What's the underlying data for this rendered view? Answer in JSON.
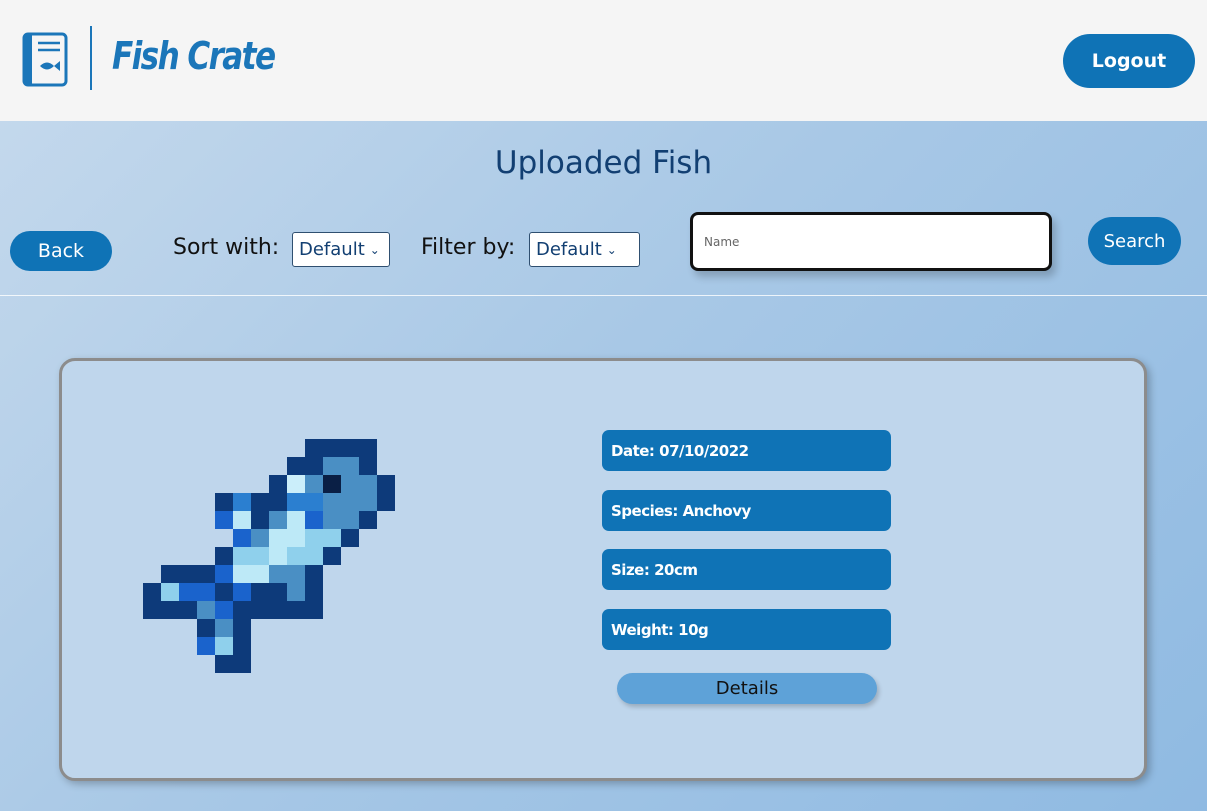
{
  "header": {
    "brand": "Fish Crate",
    "logo_icon": "fish-book-icon",
    "logout_label": "Logout"
  },
  "main": {
    "title": "Uploaded Fish",
    "back_label": "Back",
    "sort_label": "Sort with:",
    "sort_selected": "Default",
    "filter_label": "Filter by:",
    "filter_selected": "Default",
    "search_placeholder": "Name",
    "search_value": "",
    "search_label": "Search"
  },
  "fish_card": {
    "image": "pixel-fish-image",
    "date": "Date: 07/10/2022",
    "species": "Species: Anchovy",
    "size": "Size: 20cm",
    "weight": "Weight: 10g",
    "details_label": "Details"
  },
  "colors": {
    "accent": "#0f73b6",
    "title": "#123f72",
    "card_bg": "#bfd6ec",
    "details_button": "#5ea2d8"
  }
}
